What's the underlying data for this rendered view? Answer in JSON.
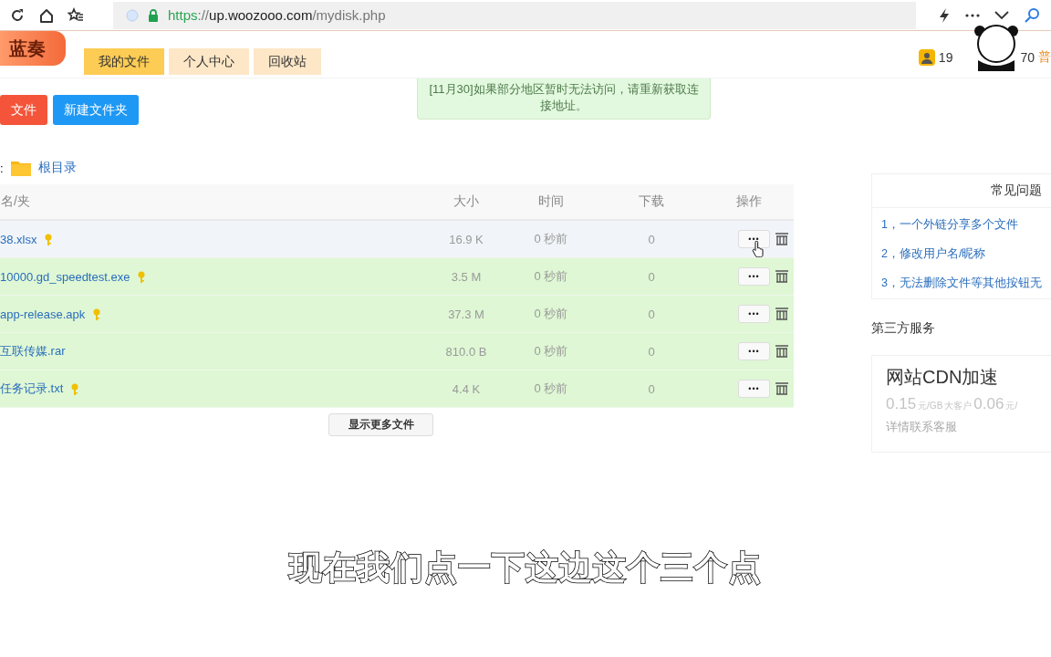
{
  "browser": {
    "url_scheme": "https",
    "url_separator": "://",
    "url_host": "up.woozooo.com",
    "url_path": "/mydisk.php"
  },
  "header": {
    "logo": "蓝奏",
    "nav": [
      {
        "label": "我的文件",
        "selected": true
      },
      {
        "label": "个人中心",
        "selected": false
      },
      {
        "label": "回收站",
        "selected": false
      }
    ],
    "user": {
      "name_start": "19",
      "name_end": "70",
      "badge": "普"
    }
  },
  "notice": "[11月30]如果部分地区暂时无法访问，请重新获取连接地址。",
  "actions": [
    {
      "label": "文件",
      "kind": "upload"
    },
    {
      "label": "新建文件夹",
      "kind": "folder"
    }
  ],
  "breadcrumb": {
    "prefix": ":",
    "folder": "根目录"
  },
  "table": {
    "columns": [
      "名/夹",
      "大小",
      "时间",
      "下载",
      "操作"
    ],
    "rows": [
      {
        "name": "38.xlsx",
        "key": true,
        "size": "16.9 K",
        "time": "0 秒前",
        "downloads": "0",
        "menu": "•••",
        "selected": true
      },
      {
        "name": "10000.gd_speedtest.exe",
        "key": true,
        "size": "3.5 M",
        "time": "0 秒前",
        "downloads": "0",
        "menu": "•••",
        "selected": false
      },
      {
        "name": "app-release.apk",
        "key": true,
        "size": "37.3 M",
        "time": "0 秒前",
        "downloads": "0",
        "menu": "•••",
        "selected": false
      },
      {
        "name": "互联传媒.rar",
        "key": false,
        "size": "810.0 B",
        "time": "0 秒前",
        "downloads": "0",
        "menu": "•••",
        "selected": false
      },
      {
        "name": "任务记录.txt",
        "key": true,
        "size": "4.4 K",
        "time": "0 秒前",
        "downloads": "0",
        "menu": "•••",
        "selected": false
      }
    ],
    "more_button": "显示更多文件"
  },
  "faq": {
    "title": "常见问题",
    "items": [
      "1，一个外链分享多个文件",
      "2，修改用户名/昵称",
      "3，无法删除文件等其他按钮无"
    ]
  },
  "services": {
    "title": "第三方服务",
    "card": {
      "title": "网站CDN加速",
      "price": [
        {
          "text": "0.15",
          "kind": "big"
        },
        {
          "text": "元/GB",
          "kind": "small"
        },
        {
          "text": "大客户",
          "kind": "small"
        },
        {
          "text": "0.06",
          "kind": "big"
        },
        {
          "text": "元/",
          "kind": "small"
        }
      ],
      "note": "详情联系客服"
    }
  },
  "subtitle": "现在我们点一下这边这个三个点"
}
